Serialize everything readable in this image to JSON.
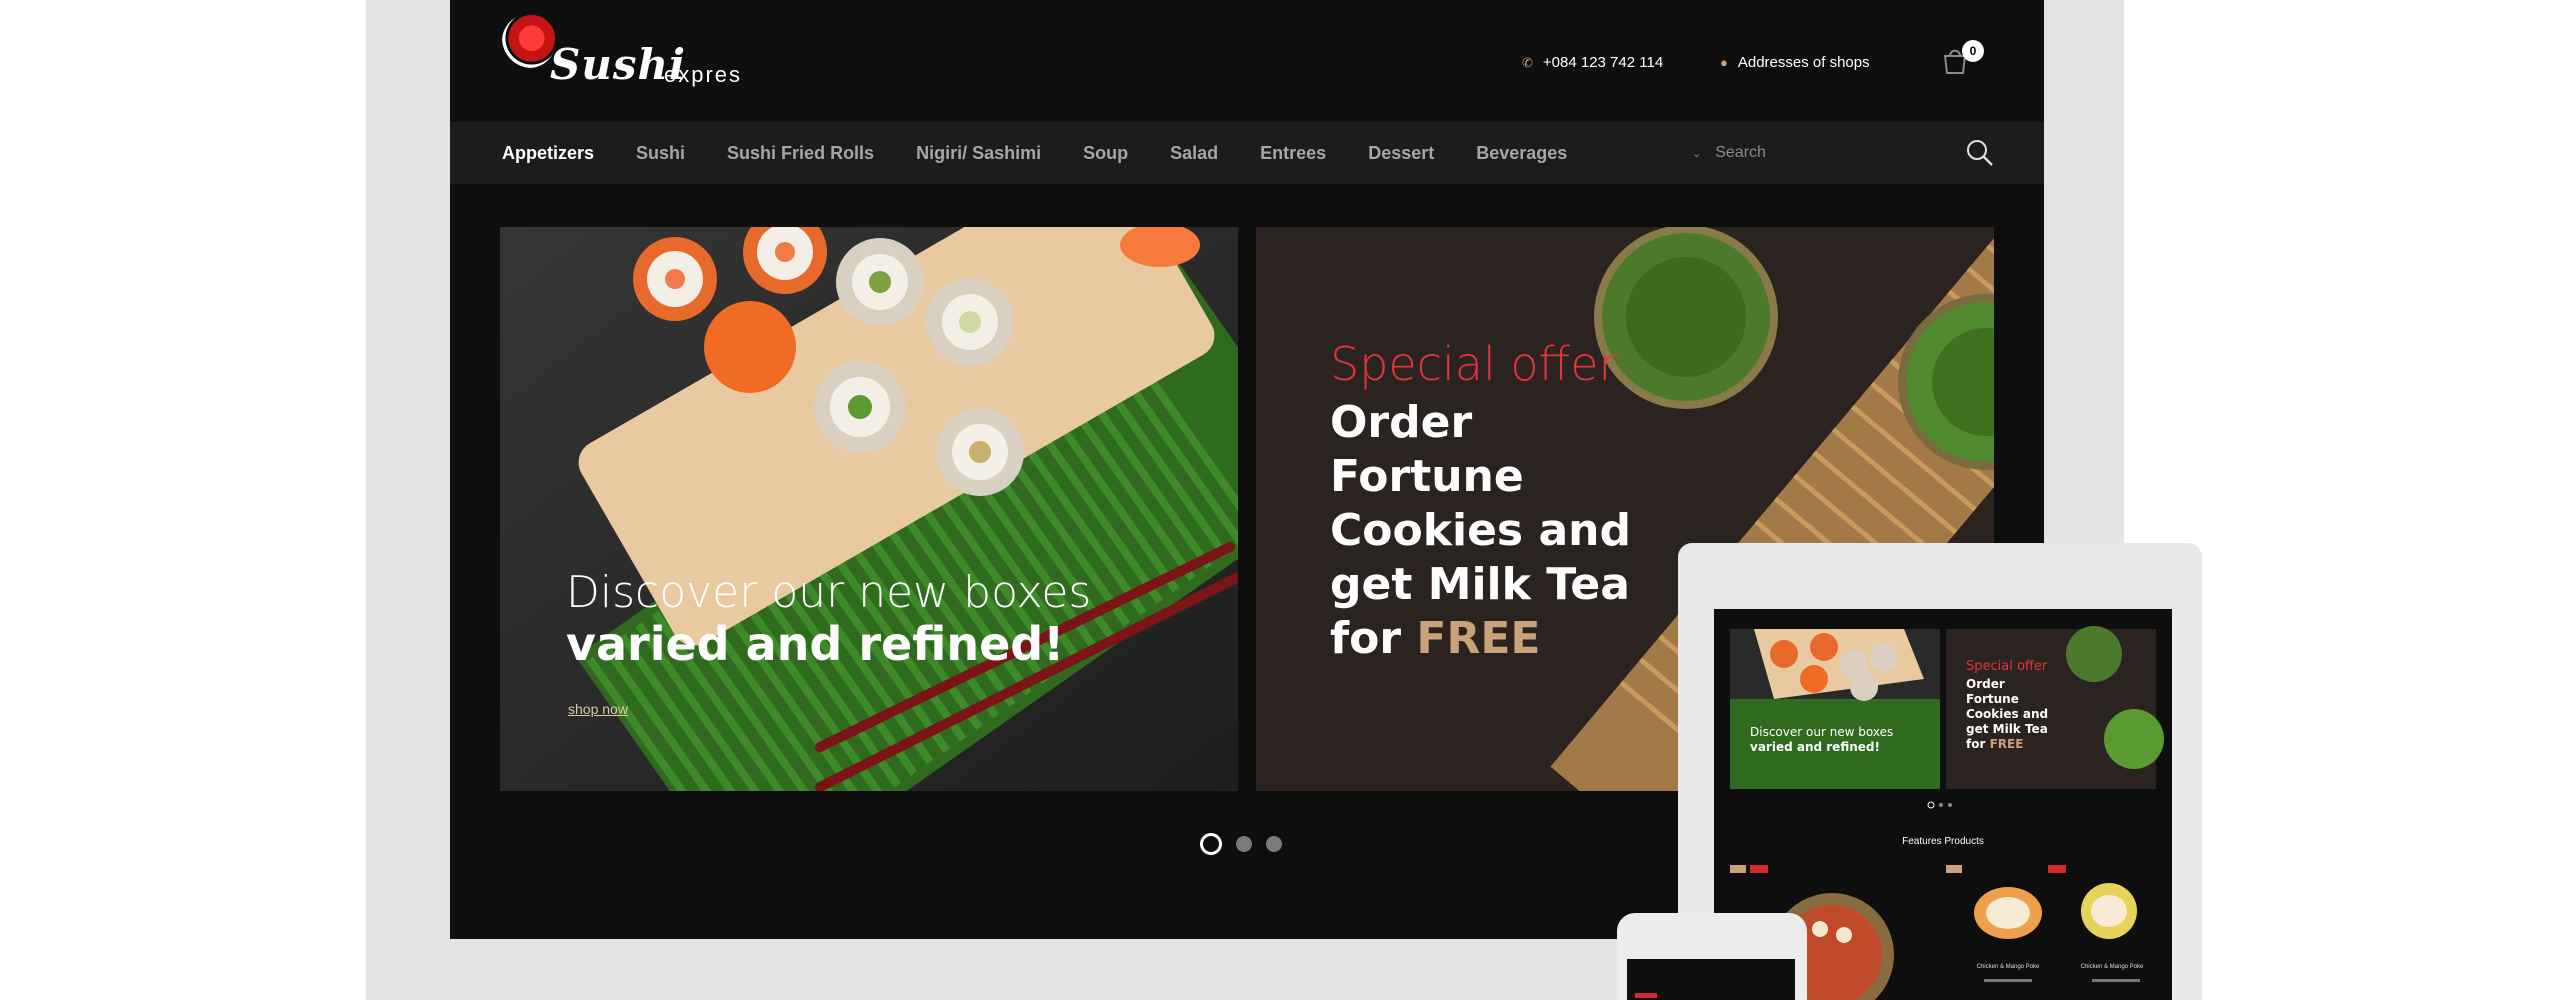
{
  "header": {
    "logo_word": "Sushi",
    "logo_sub": "expres",
    "phone": "+084 123 742 114",
    "addresses": "Addresses of shops",
    "cart_count": "0"
  },
  "nav": {
    "items": [
      {
        "label": "Appetizers",
        "active": true
      },
      {
        "label": "Sushi",
        "active": false
      },
      {
        "label": "Sushi Fried Rolls",
        "active": false
      },
      {
        "label": "Nigiri/ Sashimi",
        "active": false
      },
      {
        "label": "Soup",
        "active": false
      },
      {
        "label": "Salad",
        "active": false
      },
      {
        "label": "Entrees",
        "active": false
      },
      {
        "label": "Dessert",
        "active": false
      },
      {
        "label": "Beverages",
        "active": false
      }
    ],
    "search_placeholder": "Search"
  },
  "banner_left": {
    "line1": "Discover our new boxes",
    "line2": "varied and refined!",
    "cta": "shop now"
  },
  "banner_right": {
    "kicker": "Special offer",
    "line1": "Order",
    "line2": "Fortune",
    "line3": "Cookies and",
    "line4": "get Milk Tea",
    "line5_prefix": "for",
    "line5_highlight": "FREE"
  },
  "slider": {
    "count": 3,
    "active_index": 0
  },
  "tablet": {
    "section_title": "Features Products",
    "product_left": "Chicken & Mango Poke",
    "product_right": "Chicken & Mango Poke"
  },
  "colors": {
    "accent_red": "#e0363a",
    "accent_gold": "#c9a27a",
    "bg_dark": "#0e0e0e",
    "nav_bg": "#1c1c1c",
    "frame_gray": "#e4e4e4"
  }
}
